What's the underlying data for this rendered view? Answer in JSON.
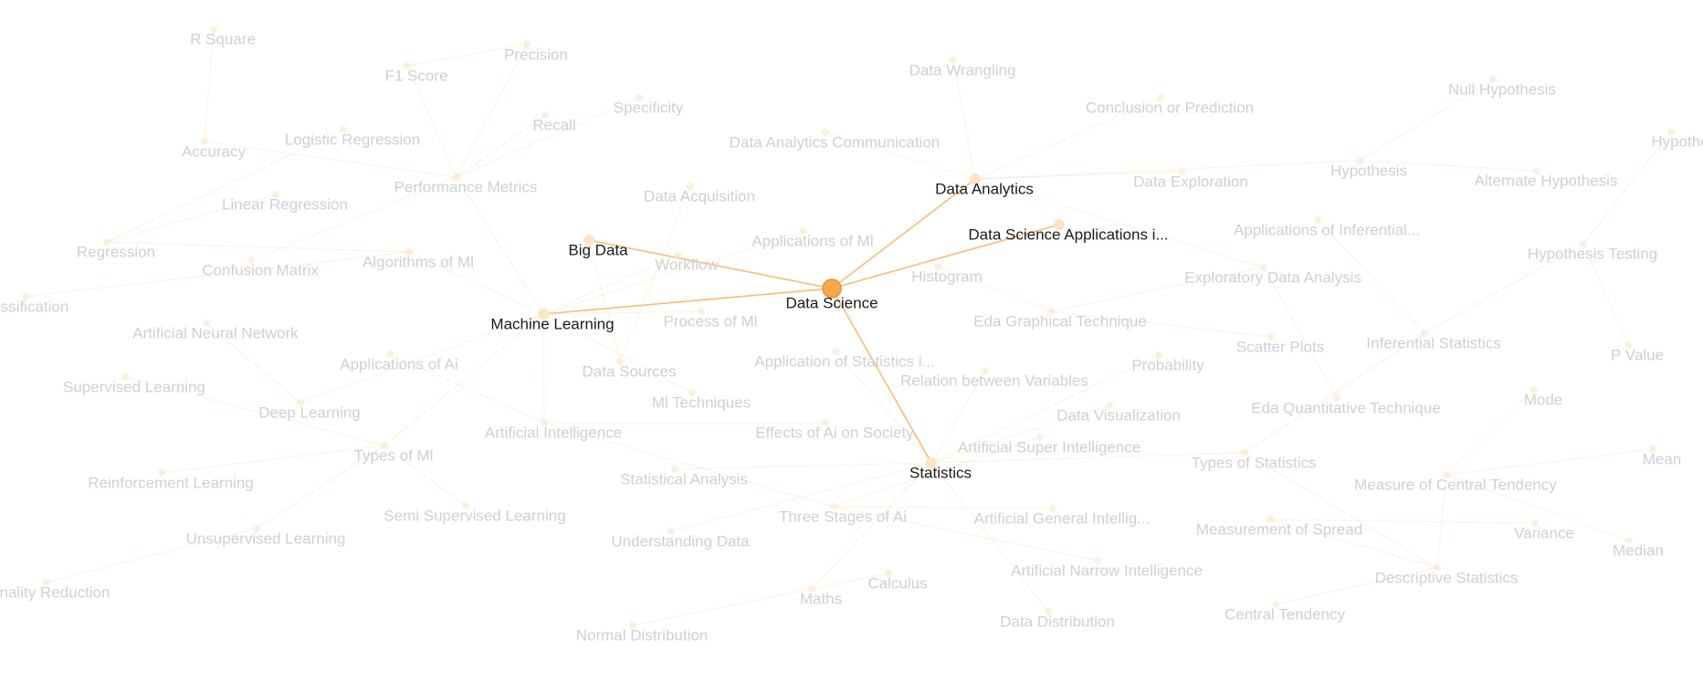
{
  "graph": {
    "center_id": "data_science",
    "nodes": [
      {
        "id": "data_science",
        "label": "Data Science",
        "active": true,
        "center": true
      },
      {
        "id": "big_data",
        "label": "Big Data",
        "active": true
      },
      {
        "id": "machine_learning",
        "label": "Machine Learning",
        "active": true
      },
      {
        "id": "data_analytics",
        "label": "Data Analytics",
        "active": true
      },
      {
        "id": "ds_applications",
        "label": "Data Science Applications i...",
        "active": true
      },
      {
        "id": "statistics",
        "label": "Statistics",
        "active": true
      },
      {
        "id": "r_square",
        "label": "R Square"
      },
      {
        "id": "f1_score",
        "label": "F1 Score"
      },
      {
        "id": "precision",
        "label": "Precision"
      },
      {
        "id": "recall",
        "label": "Recall"
      },
      {
        "id": "specificity",
        "label": "Specificity"
      },
      {
        "id": "accuracy",
        "label": "Accuracy"
      },
      {
        "id": "logistic_regression",
        "label": "Logistic Regression"
      },
      {
        "id": "performance_metrics",
        "label": "Performance Metrics"
      },
      {
        "id": "linear_regression",
        "label": "Linear Regression"
      },
      {
        "id": "regression",
        "label": "Regression"
      },
      {
        "id": "confusion_matrix",
        "label": "Confusion Matrix"
      },
      {
        "id": "algorithms_ml",
        "label": "Algorithms of Ml"
      },
      {
        "id": "classification",
        "label": "ssification"
      },
      {
        "id": "ann",
        "label": "Artificial Neural Network"
      },
      {
        "id": "applications_ai",
        "label": "Applications of Ai"
      },
      {
        "id": "supervised",
        "label": "Supervised Learning"
      },
      {
        "id": "deep_learning",
        "label": "Deep Learning"
      },
      {
        "id": "types_ml",
        "label": "Types of Ml"
      },
      {
        "id": "reinforcement",
        "label": "Reinforcement Learning"
      },
      {
        "id": "semi_supervised",
        "label": "Semi Supervised Learning"
      },
      {
        "id": "unsupervised",
        "label": "Unsupervised Learning"
      },
      {
        "id": "dim_reduction",
        "label": "nality Reduction"
      },
      {
        "id": "artificial_intelligence",
        "label": "Artificial Intelligence"
      },
      {
        "id": "data_wrangling",
        "label": "Data Wrangling"
      },
      {
        "id": "da_communication",
        "label": "Data Analytics Communication"
      },
      {
        "id": "data_acquisition",
        "label": "Data Acquisition"
      },
      {
        "id": "applications_ml",
        "label": "Applications of Ml"
      },
      {
        "id": "workflow",
        "label": "Workflow"
      },
      {
        "id": "process_ml",
        "label": "Process of Ml"
      },
      {
        "id": "data_sources",
        "label": "Data Sources"
      },
      {
        "id": "ml_techniques",
        "label": "Ml Techniques"
      },
      {
        "id": "app_statistics",
        "label": "Application of Statistics i..."
      },
      {
        "id": "effects_ai",
        "label": "Effects of Ai on Society"
      },
      {
        "id": "statistical_analysis",
        "label": "Statistical Analysis"
      },
      {
        "id": "three_stages_ai",
        "label": "Three Stages of Ai"
      },
      {
        "id": "understanding_data",
        "label": "Understanding Data"
      },
      {
        "id": "maths",
        "label": "Maths"
      },
      {
        "id": "calculus",
        "label": "Calculus"
      },
      {
        "id": "normal_distribution",
        "label": "Normal Distribution"
      },
      {
        "id": "histogram",
        "label": "Histogram"
      },
      {
        "id": "eda_graphical",
        "label": "Eda Graphical Technique"
      },
      {
        "id": "relation_variables",
        "label": "Relation between Variables"
      },
      {
        "id": "probability",
        "label": "Probability"
      },
      {
        "id": "data_visualization",
        "label": "Data Visualization"
      },
      {
        "id": "asi",
        "label": "Artificial Super Intelligence"
      },
      {
        "id": "agi",
        "label": "Artificial General Intellig..."
      },
      {
        "id": "ani",
        "label": "Artificial Narrow Intelligence"
      },
      {
        "id": "data_distribution",
        "label": "Data Distribution"
      },
      {
        "id": "conclusion_prediction",
        "label": "Conclusion or Prediction"
      },
      {
        "id": "data_exploration",
        "label": "Data Exploration"
      },
      {
        "id": "hypothesis",
        "label": "Hypothesis"
      },
      {
        "id": "null_hypothesis",
        "label": "Null Hypothesis"
      },
      {
        "id": "alternate_hypothesis",
        "label": "Alternate Hypothesis"
      },
      {
        "id": "hypothe_cut",
        "label": "Hypothe"
      },
      {
        "id": "applications_inferential",
        "label": "Applications of Inferential..."
      },
      {
        "id": "hypothesis_testing",
        "label": "Hypothesis Testing"
      },
      {
        "id": "eda",
        "label": "Exploratory Data Analysis"
      },
      {
        "id": "scatter_plots",
        "label": "Scatter Plots"
      },
      {
        "id": "inferential_statistics",
        "label": "Inferential Statistics"
      },
      {
        "id": "p_value",
        "label": "P Value"
      },
      {
        "id": "eda_quantitative",
        "label": "Eda Quantitative Technique"
      },
      {
        "id": "mode",
        "label": "Mode"
      },
      {
        "id": "types_statistics",
        "label": "Types of Statistics"
      },
      {
        "id": "central_tendency_measure",
        "label": "Measure of Central Tendency"
      },
      {
        "id": "mean",
        "label": "Mean"
      },
      {
        "id": "measurement_spread",
        "label": "Measurement of Spread"
      },
      {
        "id": "variance",
        "label": "Variance"
      },
      {
        "id": "median",
        "label": "Median"
      },
      {
        "id": "descriptive_statistics",
        "label": "Descriptive Statistics"
      },
      {
        "id": "central_tendency",
        "label": "Central Tendency"
      }
    ],
    "edges": [
      [
        "data_science",
        "big_data"
      ],
      [
        "data_science",
        "machine_learning"
      ],
      [
        "data_science",
        "data_analytics"
      ],
      [
        "data_science",
        "ds_applications"
      ],
      [
        "data_science",
        "statistics"
      ],
      [
        "r_square",
        "accuracy"
      ],
      [
        "f1_score",
        "precision"
      ],
      [
        "f1_score",
        "performance_metrics"
      ],
      [
        "precision",
        "performance_metrics"
      ],
      [
        "recall",
        "performance_metrics"
      ],
      [
        "specificity",
        "performance_metrics"
      ],
      [
        "accuracy",
        "performance_metrics"
      ],
      [
        "logistic_regression",
        "regression"
      ],
      [
        "linear_regression",
        "regression"
      ],
      [
        "regression",
        "algorithms_ml"
      ],
      [
        "confusion_matrix",
        "performance_metrics"
      ],
      [
        "performance_metrics",
        "machine_learning"
      ],
      [
        "algorithms_ml",
        "machine_learning"
      ],
      [
        "classification",
        "algorithms_ml"
      ],
      [
        "ann",
        "deep_learning"
      ],
      [
        "supervised",
        "types_ml"
      ],
      [
        "deep_learning",
        "machine_learning"
      ],
      [
        "types_ml",
        "machine_learning"
      ],
      [
        "reinforcement",
        "types_ml"
      ],
      [
        "semi_supervised",
        "types_ml"
      ],
      [
        "unsupervised",
        "types_ml"
      ],
      [
        "dim_reduction",
        "unsupervised"
      ],
      [
        "applications_ai",
        "artificial_intelligence"
      ],
      [
        "artificial_intelligence",
        "machine_learning"
      ],
      [
        "artificial_intelligence",
        "three_stages_ai"
      ],
      [
        "three_stages_ai",
        "asi"
      ],
      [
        "three_stages_ai",
        "agi"
      ],
      [
        "three_stages_ai",
        "ani"
      ],
      [
        "effects_ai",
        "artificial_intelligence"
      ],
      [
        "applications_ml",
        "machine_learning"
      ],
      [
        "workflow",
        "machine_learning"
      ],
      [
        "process_ml",
        "machine_learning"
      ],
      [
        "ml_techniques",
        "machine_learning"
      ],
      [
        "data_sources",
        "big_data"
      ],
      [
        "data_acquisition",
        "data_sources"
      ],
      [
        "data_wrangling",
        "data_analytics"
      ],
      [
        "da_communication",
        "data_analytics"
      ],
      [
        "conclusion_prediction",
        "data_analytics"
      ],
      [
        "data_exploration",
        "data_analytics"
      ],
      [
        "hypothesis",
        "data_analytics"
      ],
      [
        "eda",
        "data_analytics"
      ],
      [
        "histogram",
        "eda_graphical"
      ],
      [
        "eda_graphical",
        "eda"
      ],
      [
        "scatter_plots",
        "eda_graphical"
      ],
      [
        "data_visualization",
        "statistics"
      ],
      [
        "relation_variables",
        "statistics"
      ],
      [
        "probability",
        "statistics"
      ],
      [
        "app_statistics",
        "statistics"
      ],
      [
        "statistical_analysis",
        "statistics"
      ],
      [
        "understanding_data",
        "statistics"
      ],
      [
        "maths",
        "statistics"
      ],
      [
        "calculus",
        "maths"
      ],
      [
        "normal_distribution",
        "maths"
      ],
      [
        "data_distribution",
        "statistics"
      ],
      [
        "null_hypothesis",
        "hypothesis"
      ],
      [
        "alternate_hypothesis",
        "hypothesis"
      ],
      [
        "hypothesis_testing",
        "inferential_statistics"
      ],
      [
        "hypothe_cut",
        "hypothesis_testing"
      ],
      [
        "applications_inferential",
        "inferential_statistics"
      ],
      [
        "p_value",
        "hypothesis_testing"
      ],
      [
        "inferential_statistics",
        "types_statistics"
      ],
      [
        "eda_quantitative",
        "eda"
      ],
      [
        "types_statistics",
        "statistics"
      ],
      [
        "descriptive_statistics",
        "types_statistics"
      ],
      [
        "central_tendency_measure",
        "descriptive_statistics"
      ],
      [
        "mode",
        "central_tendency_measure"
      ],
      [
        "mean",
        "central_tendency_measure"
      ],
      [
        "median",
        "central_tendency_measure"
      ],
      [
        "measurement_spread",
        "descriptive_statistics"
      ],
      [
        "variance",
        "measurement_spread"
      ],
      [
        "central_tendency",
        "descriptive_statistics"
      ]
    ]
  }
}
